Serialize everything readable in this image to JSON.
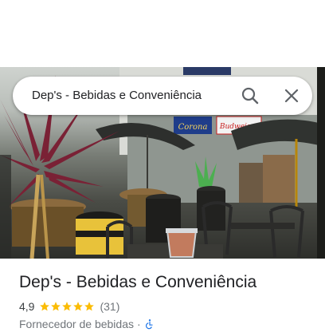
{
  "search": {
    "query": "Dep's - Bebidas e Conveniência"
  },
  "photo": {
    "sign_corona": "Corona",
    "sign_budweiser": "Budweiser"
  },
  "place": {
    "name": "Dep's - Bebidas e Conveniência",
    "rating": "4,9",
    "stars": 5,
    "review_count": "(31)",
    "category": "Fornecedor de bebidas",
    "separator": "·"
  },
  "icons": {
    "search": "search-icon",
    "close": "close-icon",
    "star": "star-icon",
    "accessibility": "wheelchair-icon"
  },
  "colors": {
    "star": "#fbbc04",
    "accessibility": "#1a73e8",
    "text_primary": "#202124",
    "text_secondary": "#70757a"
  }
}
